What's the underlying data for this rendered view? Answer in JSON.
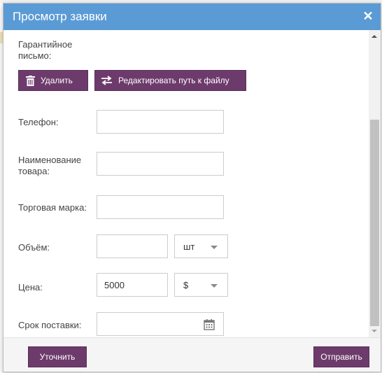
{
  "dialog": {
    "title": "Просмотр заявки",
    "close_symbol": "✕"
  },
  "form": {
    "guarantee_label": "Гарантийное письмо:",
    "delete_button": "Удалить",
    "edit_path_button": "Редактировать путь к файлу",
    "phone_label": "Телефон:",
    "phone_value": "",
    "product_name_label": "Наименование товара:",
    "product_name_value": "",
    "brand_label": "Торговая марка:",
    "brand_value": "",
    "volume_label": "Объём:",
    "volume_value": "",
    "volume_unit": "шт",
    "price_label": "Цена:",
    "price_value": "5000",
    "currency": "$",
    "delivery_label": "Срок поставки:",
    "delivery_value": ""
  },
  "footer": {
    "clarify_button": "Уточнить",
    "send_button": "Отправить"
  },
  "colors": {
    "titlebar": "#5b9bd5",
    "button": "#6d3b6b"
  },
  "icons": [
    "trash-icon",
    "swap-arrows-icon",
    "close-icon",
    "calendar-icon",
    "chevron-down-icon"
  ]
}
